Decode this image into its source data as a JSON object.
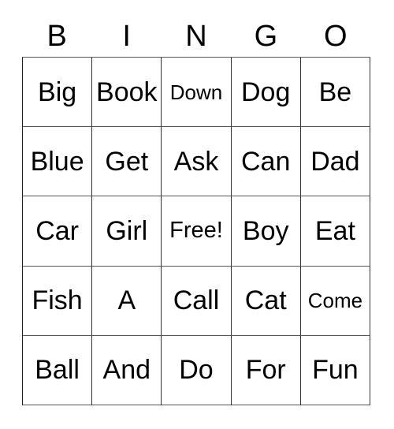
{
  "card": {
    "headers": [
      "B",
      "I",
      "N",
      "G",
      "O"
    ],
    "text_color": "#000000",
    "background_color": "#ffffff",
    "border_color": "#333333",
    "rows": [
      [
        {
          "label": "Big",
          "size": "lg",
          "free": false
        },
        {
          "label": "Book",
          "size": "lg",
          "free": false
        },
        {
          "label": "Down",
          "size": "sm",
          "free": false
        },
        {
          "label": "Dog",
          "size": "lg",
          "free": false
        },
        {
          "label": "Be",
          "size": "lg",
          "free": false
        }
      ],
      [
        {
          "label": "Blue",
          "size": "lg",
          "free": false
        },
        {
          "label": "Get",
          "size": "lg",
          "free": false
        },
        {
          "label": "Ask",
          "size": "lg",
          "free": false
        },
        {
          "label": "Can",
          "size": "lg",
          "free": false
        },
        {
          "label": "Dad",
          "size": "lg",
          "free": false
        }
      ],
      [
        {
          "label": "Car",
          "size": "lg",
          "free": false
        },
        {
          "label": "Girl",
          "size": "lg",
          "free": false
        },
        {
          "label": "Free!",
          "size": "md",
          "free": true
        },
        {
          "label": "Boy",
          "size": "lg",
          "free": false
        },
        {
          "label": "Eat",
          "size": "lg",
          "free": false
        }
      ],
      [
        {
          "label": "Fish",
          "size": "lg",
          "free": false
        },
        {
          "label": "A",
          "size": "lg",
          "free": false
        },
        {
          "label": "Call",
          "size": "lg",
          "free": false
        },
        {
          "label": "Cat",
          "size": "lg",
          "free": false
        },
        {
          "label": "Come",
          "size": "sm",
          "free": false
        }
      ],
      [
        {
          "label": "Ball",
          "size": "lg",
          "free": false
        },
        {
          "label": "And",
          "size": "lg",
          "free": false
        },
        {
          "label": "Do",
          "size": "lg",
          "free": false
        },
        {
          "label": "For",
          "size": "lg",
          "free": false
        },
        {
          "label": "Fun",
          "size": "lg",
          "free": false
        }
      ]
    ]
  }
}
